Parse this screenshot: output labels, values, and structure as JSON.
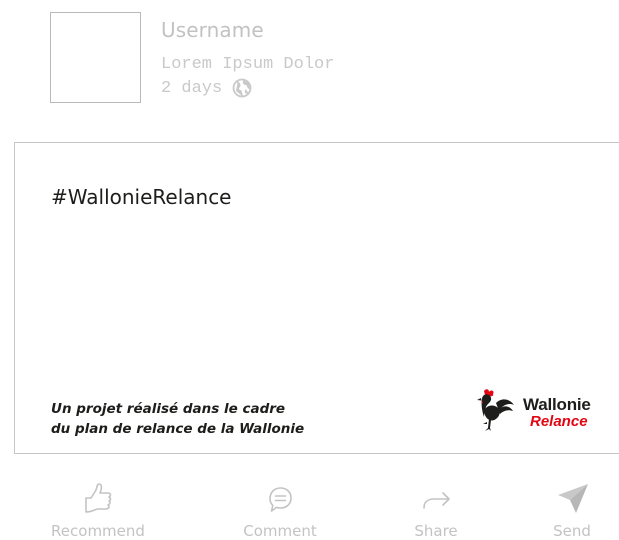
{
  "post": {
    "username": "Username",
    "subtitle": "Lorem Ipsum Dolor",
    "time": "2 days",
    "visibility_icon": "globe-icon"
  },
  "card": {
    "hashtag": "#WallonieRelance",
    "project_line_1": "Un projet réalisé dans le cadre",
    "project_line_2": "du plan de relance de la Wallonie",
    "logo": {
      "word_1": "Wallonie",
      "word_2": "Relance",
      "accent_color": "#e30613",
      "text_color": "#1d1d1b"
    }
  },
  "actions": [
    {
      "label": "Recommend",
      "icon": "thumbs-up-icon"
    },
    {
      "label": "Comment",
      "icon": "comment-icon"
    },
    {
      "label": "Share",
      "icon": "share-arrow-icon"
    },
    {
      "label": "Send",
      "icon": "send-icon"
    }
  ],
  "colors": {
    "muted_text": "#c3c3c3",
    "border": "#c6c6c6"
  }
}
